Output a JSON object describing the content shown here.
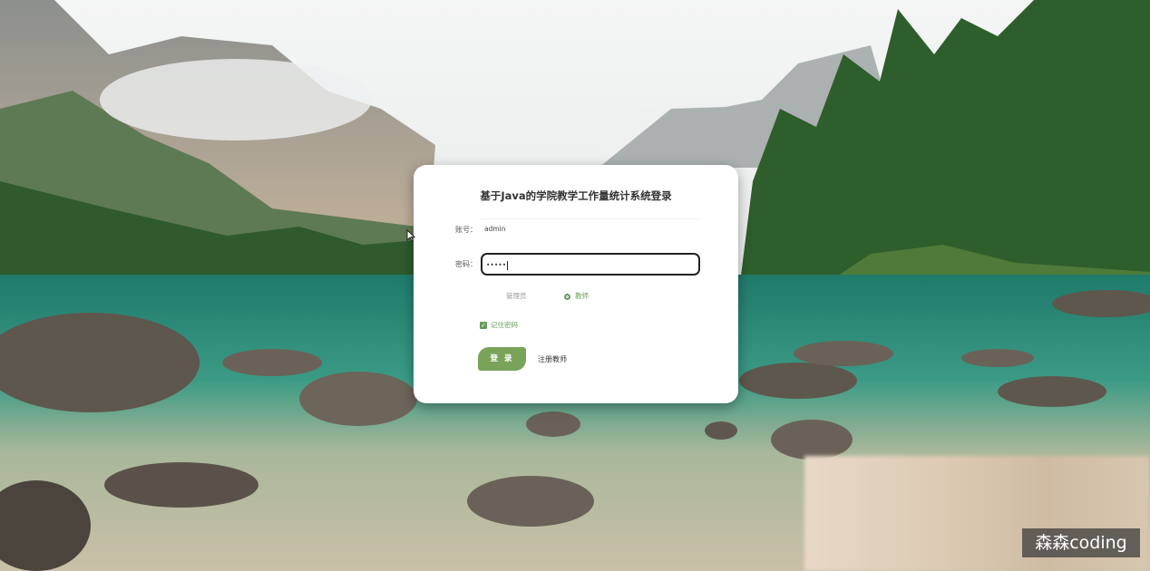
{
  "login": {
    "title": "基于Java的学院教学工作量统计系统登录",
    "username_label": "账号：",
    "username_value": "admin",
    "password_label": "密码：",
    "password_mask": "•••••",
    "roles": [
      {
        "label": "管理员",
        "selected": false
      },
      {
        "label": "教师",
        "selected": true
      }
    ],
    "remember_label": "记住密码",
    "remember_checked": true,
    "login_button": "登 录",
    "register_link": "注册教师"
  },
  "overlay": {
    "watermark": "森森coding"
  },
  "colors": {
    "accent": "#7aa35a",
    "card_bg": "#ffffff"
  },
  "icons": [
    "mouse-cursor-icon",
    "checkbox-check-icon",
    "radio-icon"
  ]
}
